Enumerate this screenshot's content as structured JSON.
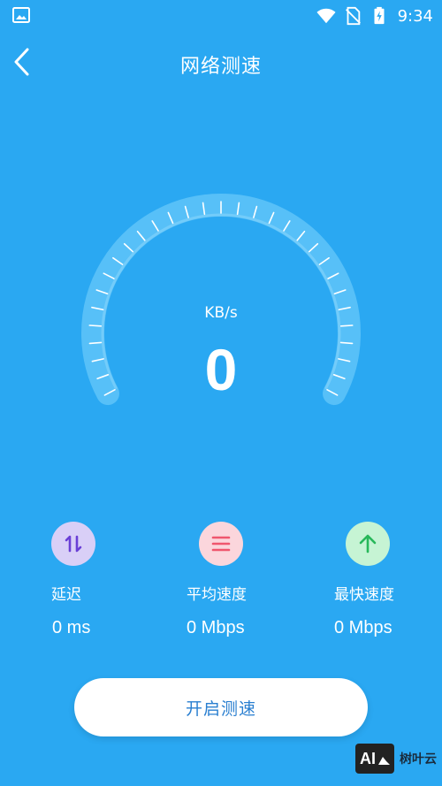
{
  "status_bar": {
    "time": "9:34",
    "icons": [
      "image-icon",
      "wifi-icon",
      "no-sim-icon",
      "battery-charging-icon"
    ]
  },
  "header": {
    "back_icon": "chevron-left-icon",
    "title": "网络测速"
  },
  "gauge": {
    "unit": "KB/s",
    "value": "0"
  },
  "stats": {
    "latency": {
      "icon": "up-down-arrows-icon",
      "label": "延迟",
      "value": "0 ms",
      "color": "#6a3fd6"
    },
    "average": {
      "icon": "menu-lines-icon",
      "label": "平均速度",
      "value": "0 Mbps",
      "color": "#f0566e"
    },
    "max": {
      "icon": "arrow-up-icon",
      "label": "最快速度",
      "value": "0 Mbps",
      "color": "#27b85a"
    }
  },
  "start_button": {
    "label": "开启测速"
  },
  "watermark": {
    "logo_text": "AI",
    "text": "树叶云"
  },
  "colors": {
    "background": "#2aa8f2",
    "button_text": "#2a7fd0"
  }
}
